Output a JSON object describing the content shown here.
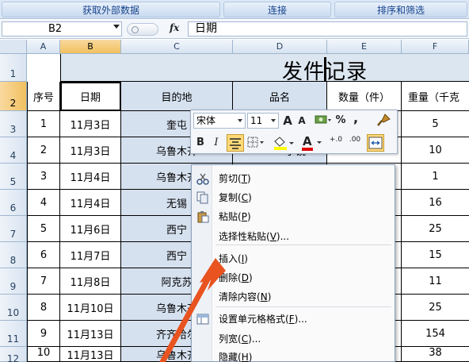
{
  "ribbon": {
    "groups": [
      "获取外部数据",
      "连接",
      "排序和筛选"
    ]
  },
  "formula_bar": {
    "name_box": "B2",
    "fx_label": "fx",
    "content": "日期"
  },
  "columns": [
    "A",
    "B",
    "C",
    "D",
    "E",
    "F"
  ],
  "rows": [
    "1",
    "2",
    "3",
    "4",
    "5",
    "6",
    "7",
    "8",
    "9",
    "10",
    "11",
    "12"
  ],
  "sheet": {
    "title": "发件记录",
    "headers": [
      "序号",
      "日期",
      "目的地",
      "品名",
      "数量（件）",
      "重量（千克"
    ],
    "data": [
      {
        "seq": "1",
        "date": "11月3日",
        "dest": "奎屯",
        "weight": "5"
      },
      {
        "seq": "2",
        "date": "11月3日",
        "dest": "乌鲁木齐",
        "weight": "10"
      },
      {
        "seq": "3",
        "date": "11月4日",
        "dest": "乌鲁木齐",
        "weight": "1"
      },
      {
        "seq": "4",
        "date": "11月4日",
        "dest": "无锡",
        "weight": "16"
      },
      {
        "seq": "5",
        "date": "11月6日",
        "dest": "西宁",
        "weight": "25"
      },
      {
        "seq": "6",
        "date": "11月7日",
        "dest": "西宁",
        "weight": "15"
      },
      {
        "seq": "7",
        "date": "11月8日",
        "dest": "阿克苏",
        "weight": "11"
      },
      {
        "seq": "8",
        "date": "11月10日",
        "dest": "乌鲁木齐",
        "weight": "25"
      },
      {
        "seq": "9",
        "date": "11月13日",
        "dest": "齐齐哈尔",
        "weight": "154"
      },
      {
        "seq": "10",
        "date": "11月13日",
        "dest": "乌鲁木齐",
        "weight": "38"
      }
    ],
    "d4_partial": "子镜"
  },
  "mini_toolbar": {
    "font": "宋体",
    "size": "11",
    "grow_font": "A",
    "shrink_font": "A",
    "percent": "%",
    "comma": ",",
    "bold": "B",
    "italic": "I",
    "font_color_letter": "A",
    "inc_decimal": "+.0",
    "dec_decimal": ".00"
  },
  "context_menu": {
    "items": [
      {
        "label": "剪切",
        "key": "T"
      },
      {
        "label": "复制",
        "key": "C"
      },
      {
        "label": "粘贴",
        "key": "P"
      },
      {
        "label": "选择性粘贴",
        "key": "V",
        "suffix": "..."
      },
      {
        "label": "插入",
        "key": "I"
      },
      {
        "label": "删除",
        "key": "D"
      },
      {
        "label": "清除内容",
        "key": "N"
      },
      {
        "label": "设置单元格格式",
        "key": "F",
        "suffix": "..."
      },
      {
        "label": "列宽",
        "key": "C",
        "suffix": "..."
      },
      {
        "label": "隐藏",
        "key": "H"
      }
    ]
  },
  "colors": {
    "selection_header": "#f1c15f",
    "highlight_fill": "#d6e1ef",
    "arrow": "#e8531f"
  }
}
